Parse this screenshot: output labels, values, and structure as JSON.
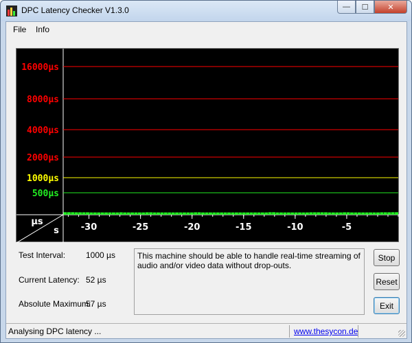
{
  "window": {
    "title": "DPC Latency Checker V1.3.0"
  },
  "menu": [
    "File",
    "Info"
  ],
  "graph": {
    "y_labels": [
      "16000µs",
      "8000µs",
      "4000µs",
      "2000µs",
      "1000µs",
      "500µs"
    ],
    "y_unit": "µs",
    "x_unit": "s",
    "x_labels": [
      "-30",
      "-25",
      "-20",
      "-15",
      "-10",
      "-5"
    ],
    "colors": {
      "red": "#ff0000",
      "yellow": "#ffff00",
      "green": "#22ee22",
      "bars": "#22ee22"
    },
    "bar_levels_us": [
      57,
      57,
      57,
      55,
      55,
      55,
      55,
      52,
      52,
      52,
      52,
      52,
      52,
      52,
      52,
      55,
      52,
      52,
      52,
      52,
      52,
      52,
      55,
      55,
      52,
      52,
      52,
      52,
      52,
      52,
      52,
      52,
      52,
      52,
      52,
      55,
      55,
      52,
      52,
      52,
      52,
      52,
      52,
      52,
      52,
      52,
      52,
      52,
      52,
      52,
      52,
      52,
      52,
      52,
      52,
      57,
      57,
      52,
      52,
      52,
      52,
      52,
      52,
      52,
      52,
      52,
      55,
      55,
      55,
      55,
      55,
      52,
      52,
      52,
      52,
      55,
      55,
      52,
      52,
      52,
      52,
      52,
      52,
      52,
      52,
      55,
      55,
      55,
      57,
      57
    ]
  },
  "info": {
    "test_interval_label": "Test Interval:",
    "test_interval_value": "1000 µs",
    "current_latency_label": "Current Latency:",
    "current_latency_value": "52 µs",
    "absolute_maximum_label": "Absolute Maximum:",
    "absolute_maximum_value": "57 µs"
  },
  "message": "This machine should be able to handle real-time streaming of audio and/or video data without drop-outs.",
  "buttons": {
    "stop": "Stop",
    "reset": "Reset",
    "exit": "Exit"
  },
  "status": {
    "text": "Analysing DPC latency ...",
    "link": "www.thesycon.de"
  }
}
